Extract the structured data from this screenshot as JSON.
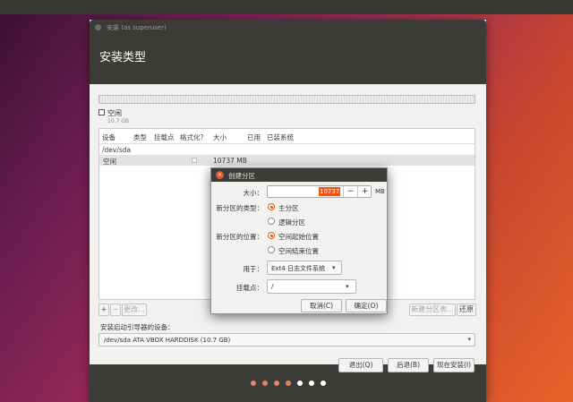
{
  "window": {
    "title": "安装 (as superuser)",
    "heading": "安装类型"
  },
  "legend": {
    "label": "空闲",
    "size": "10.7 GB"
  },
  "table": {
    "columns": [
      "设备",
      "类型",
      "挂载点",
      "格式化？",
      "大小",
      "已用",
      "已装系统"
    ],
    "device": "/dev/sda",
    "rows": [
      {
        "device": "空闲",
        "type": "",
        "mount": "",
        "format": false,
        "size": "10737 MB",
        "used": "",
        "system": ""
      }
    ]
  },
  "table_buttons": {
    "add": "+",
    "remove": "−",
    "change": "更改...",
    "new_table": "新建分区表...",
    "revert": "还原"
  },
  "bootloader": {
    "label": "安装启动引导器的设备：",
    "value": "/dev/sda ATA VBOX HARDDISK (10.7 GB)"
  },
  "footer": {
    "quit": "退出(Q)",
    "back": "后退(B)",
    "install_now": "现在安装(I)"
  },
  "progress_dots": {
    "total": 7,
    "active": 4,
    "active_color": "#e4855d",
    "inactive_color": "#ffffff"
  },
  "dialog": {
    "title": "创建分区",
    "size_label": "大小：",
    "size_value": "10737",
    "size_minus": "−",
    "size_plus": "+",
    "size_unit": "MB",
    "type_label": "新分区的类型：",
    "type_primary": "主分区",
    "type_logical": "逻辑分区",
    "location_label": "新分区的位置：",
    "location_start": "空间起始位置",
    "location_end": "空间结束位置",
    "use_label": "用于：",
    "use_value": "Ext4 日志文件系统",
    "mount_label": "挂载点：",
    "mount_value": "/",
    "cancel": "取消(C)",
    "ok": "确定(O)"
  },
  "colors": {
    "accent": "#e95420",
    "header_bg": "#3c3b37",
    "window_bg": "#f2f1f0"
  }
}
